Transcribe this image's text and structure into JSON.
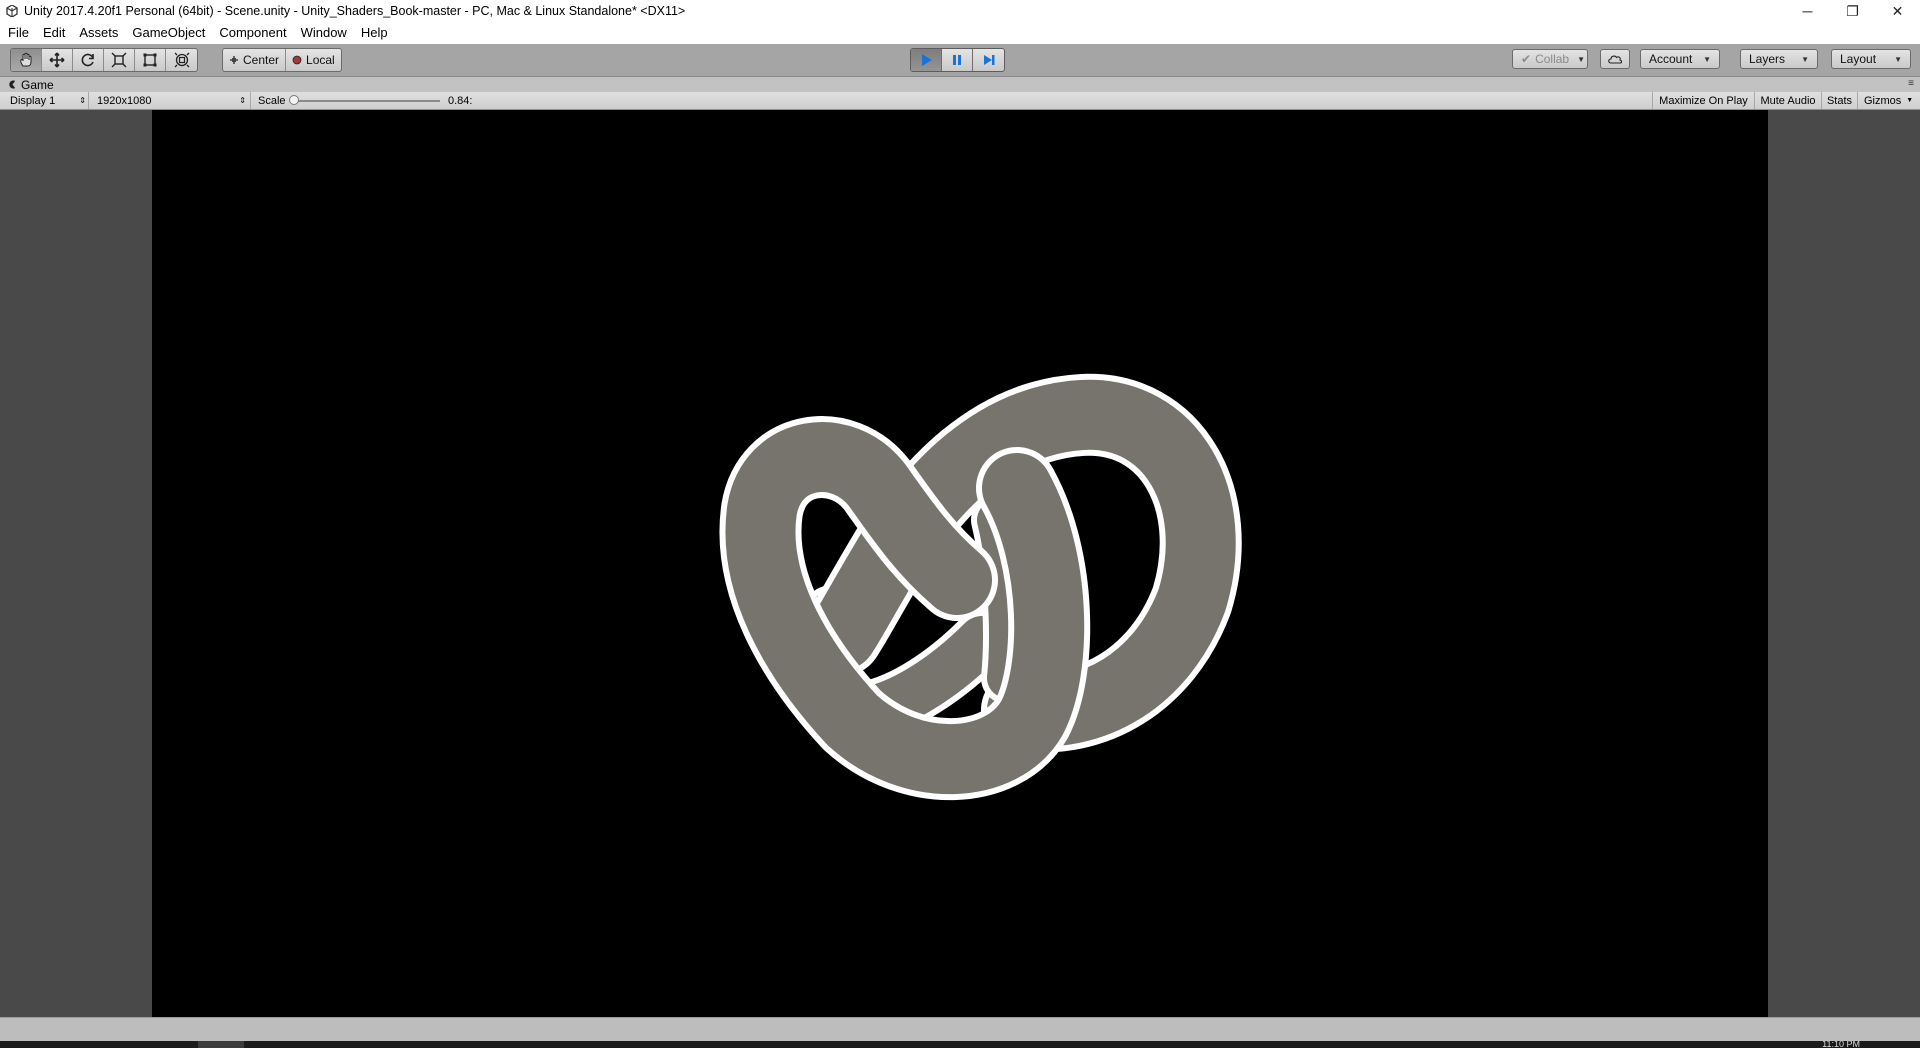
{
  "window": {
    "title": "Unity 2017.4.20f1 Personal (64bit) - Scene.unity - Unity_Shaders_Book-master - PC, Mac & Linux Standalone* <DX11>",
    "controls": {
      "minimize": "─",
      "restore": "❐",
      "close": "✕"
    }
  },
  "menu": [
    "File",
    "Edit",
    "Assets",
    "GameObject",
    "Component",
    "Window",
    "Help"
  ],
  "toolbar": {
    "tools": [
      "hand-icon",
      "move-icon",
      "rotate-icon",
      "scale-icon",
      "rect-icon",
      "transform-icon"
    ],
    "pivot_center": "Center",
    "pivot_local": "Local",
    "play": [
      "play-icon",
      "pause-icon",
      "step-icon"
    ],
    "collab": "Collab",
    "account": "Account",
    "layers": "Layers",
    "layout": "Layout"
  },
  "game": {
    "tab_label": "Game",
    "display": "Display 1",
    "resolution": "1920x1080",
    "scale_label": "Scale",
    "scale_value": "0.84:",
    "maximize": "Maximize On Play",
    "mute": "Mute Audio",
    "stats": "Stats",
    "gizmos": "Gizmos"
  },
  "taskbar": {
    "clock": "11:10 PM"
  },
  "colors": {
    "play_accent": "#1a73d9",
    "knot_fill": "#76746d",
    "outline": "#ffffff",
    "viewport_bg": "#000000"
  }
}
